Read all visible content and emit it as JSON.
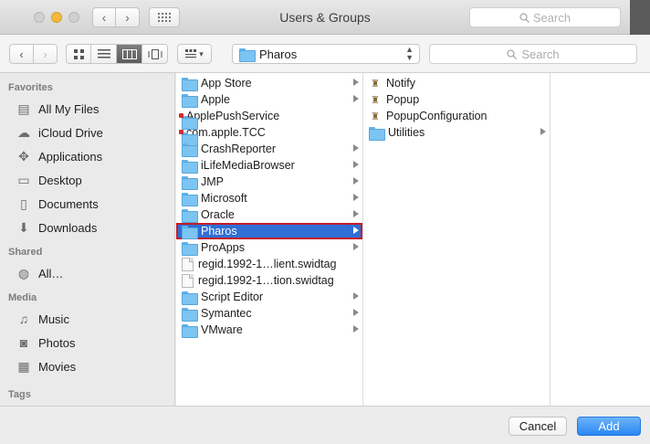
{
  "window": {
    "title": "Users & Groups",
    "search_placeholder": "Search"
  },
  "toolbar": {
    "back_icon": "chevron-left-icon",
    "forward_icon": "chevron-right-icon",
    "path_label": "Pharos",
    "search_placeholder": "Search"
  },
  "sidebar": {
    "sections": [
      {
        "title": "Favorites",
        "items": [
          {
            "label": "All My Files",
            "icon": "all-files-icon"
          },
          {
            "label": "iCloud Drive",
            "icon": "cloud-icon"
          },
          {
            "label": "Applications",
            "icon": "applications-icon"
          },
          {
            "label": "Desktop",
            "icon": "desktop-icon"
          },
          {
            "label": "Documents",
            "icon": "documents-icon"
          },
          {
            "label": "Downloads",
            "icon": "downloads-icon"
          }
        ]
      },
      {
        "title": "Shared",
        "items": [
          {
            "label": "All…",
            "icon": "network-icon"
          }
        ]
      },
      {
        "title": "Media",
        "items": [
          {
            "label": "Music",
            "icon": "music-icon"
          },
          {
            "label": "Photos",
            "icon": "camera-icon"
          },
          {
            "label": "Movies",
            "icon": "film-icon"
          }
        ]
      },
      {
        "title": "Tags",
        "items": []
      }
    ]
  },
  "column1": [
    {
      "label": "App Store",
      "kind": "folder",
      "arrow": true
    },
    {
      "label": "Apple",
      "kind": "folder",
      "arrow": true
    },
    {
      "label": "ApplePushService",
      "kind": "folder-badged",
      "arrow": false
    },
    {
      "label": "com.apple.TCC",
      "kind": "folder-badged",
      "arrow": false
    },
    {
      "label": "CrashReporter",
      "kind": "folder",
      "arrow": true
    },
    {
      "label": "iLifeMediaBrowser",
      "kind": "folder",
      "arrow": true
    },
    {
      "label": "JMP",
      "kind": "folder",
      "arrow": true
    },
    {
      "label": "Microsoft",
      "kind": "folder",
      "arrow": true
    },
    {
      "label": "Oracle",
      "kind": "folder",
      "arrow": true
    },
    {
      "label": "Pharos",
      "kind": "folder",
      "arrow": true,
      "selected": true
    },
    {
      "label": "ProApps",
      "kind": "folder",
      "arrow": true
    },
    {
      "label": "regid.1992-1…lient.swidtag",
      "kind": "document",
      "arrow": false
    },
    {
      "label": "regid.1992-1…tion.swidtag",
      "kind": "document",
      "arrow": false
    },
    {
      "label": "Script Editor",
      "kind": "folder",
      "arrow": true
    },
    {
      "label": "Symantec",
      "kind": "folder",
      "arrow": true
    },
    {
      "label": "VMware",
      "kind": "folder",
      "arrow": true
    }
  ],
  "column2": [
    {
      "label": "Notify",
      "kind": "app",
      "arrow": false
    },
    {
      "label": "Popup",
      "kind": "app",
      "arrow": false
    },
    {
      "label": "PopupConfiguration",
      "kind": "app",
      "arrow": false
    },
    {
      "label": "Utilities",
      "kind": "folder",
      "arrow": true
    }
  ],
  "footer": {
    "cancel_label": "Cancel",
    "add_label": "Add"
  },
  "colors": {
    "selection": "#2f6fd6",
    "highlight_outline": "#c51d28",
    "primary_button": "#2a87f3"
  }
}
